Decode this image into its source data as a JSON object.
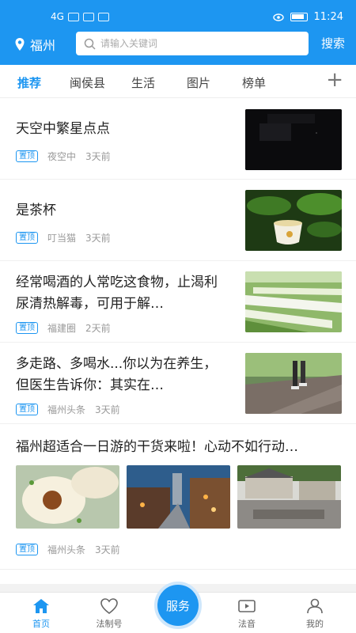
{
  "statusbar": {
    "time": "11:24",
    "network": "4G"
  },
  "header": {
    "location": "福州",
    "search_placeholder": "请输入关键词",
    "search_button": "搜索"
  },
  "tabs": [
    {
      "label": "推荐",
      "active": true
    },
    {
      "label": "闽侯县"
    },
    {
      "label": "生活"
    },
    {
      "label": "图片"
    },
    {
      "label": "榜单"
    }
  ],
  "feed": [
    {
      "title": "天空中繁星点点",
      "badge": "置顶",
      "source": "夜空中",
      "time": "3天前",
      "image": "night-sky"
    },
    {
      "title": "是茶杯",
      "badge": "置顶",
      "source": "叮当猫",
      "time": "3天前",
      "image": "tea-cup"
    },
    {
      "title": "经常喝酒的人常吃这食物，止渴利尿清热解毒，可用于解…",
      "badge": "置顶",
      "source": "福建圈",
      "time": "2天前",
      "image": "vegetables"
    },
    {
      "title": "多走路、多喝水...你以为在养生，但医生告诉你：其实在…",
      "badge": "置顶",
      "source": "福州头条",
      "time": "3天前",
      "image": "walking"
    },
    {
      "title": "福州超适合一日游的干货来啦！心动不如行动…",
      "badge": "置顶",
      "source": "福州头条",
      "time": "3天前",
      "images": [
        "dumplings",
        "street",
        "village"
      ]
    }
  ],
  "nav": [
    {
      "label": "首页",
      "icon": "home-icon",
      "active": true
    },
    {
      "label": "法制号",
      "icon": "heart-icon"
    },
    {
      "label": "服务",
      "icon": "service-button"
    },
    {
      "label": "法音",
      "icon": "video-icon"
    },
    {
      "label": "我的",
      "icon": "user-icon"
    }
  ],
  "colors": {
    "brand": "#1d96f1"
  }
}
